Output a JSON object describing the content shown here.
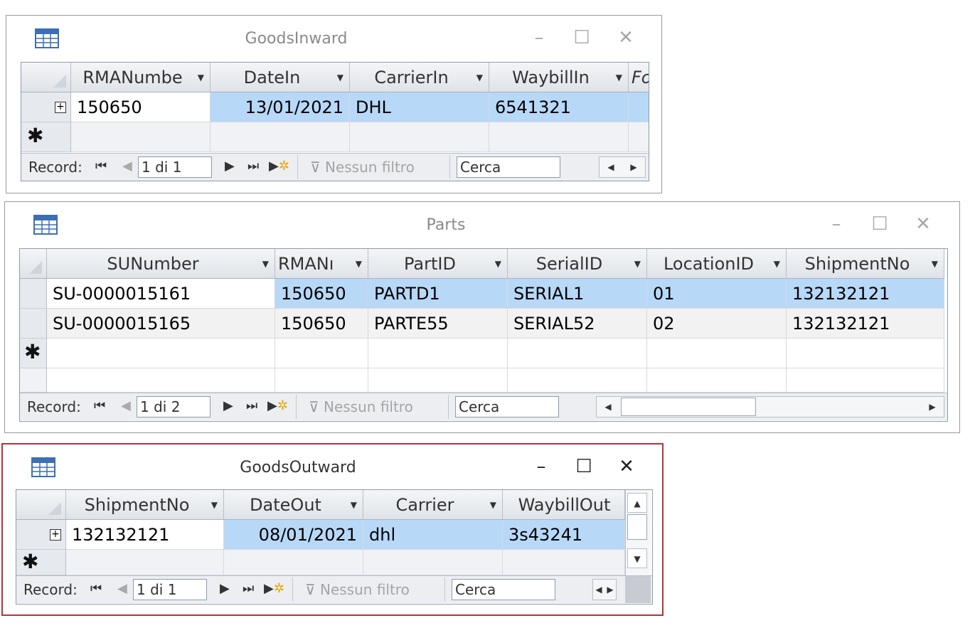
{
  "windows": {
    "inward": {
      "title": "GoodsInward",
      "columns": [
        "RMANumbe",
        "DateIn",
        "CarrierIn",
        "WaybillIn",
        "Fo"
      ],
      "row": [
        "150650",
        "13/01/2021",
        "DHL",
        "6541321"
      ],
      "nav": {
        "record_label": "Record:",
        "position": "1 di 1",
        "filter": "Nessun filtro",
        "search": "Cerca"
      }
    },
    "parts": {
      "title": "Parts",
      "columns": [
        "SUNumber",
        "RMANı",
        "PartID",
        "SerialID",
        "LocationID",
        "ShipmentNo"
      ],
      "rows": [
        [
          "SU-0000015161",
          "150650",
          "PARTD1",
          "SERIAL1",
          "01",
          "132132121"
        ],
        [
          "SU-0000015165",
          "150650",
          "PARTE55",
          "SERIAL52",
          "02",
          "132132121"
        ]
      ],
      "nav": {
        "record_label": "Record:",
        "position": "1 di 2",
        "filter": "Nessun filtro",
        "search": "Cerca"
      }
    },
    "outward": {
      "title": "GoodsOutward",
      "columns": [
        "ShipmentNo",
        "DateOut",
        "Carrier",
        "WaybillOut"
      ],
      "row": [
        "132132121",
        "08/01/2021",
        "dhl",
        "3s43241"
      ],
      "nav": {
        "record_label": "Record:",
        "position": "1 di 1",
        "filter": "Nessun filtro",
        "search": "Cerca"
      }
    }
  },
  "icons": {
    "table": "datasheet-table-icon",
    "new_row": "asterisk-icon",
    "expand": "plus-box-icon"
  },
  "colors": {
    "selected_cell": "#b8d8f8",
    "active_border": "#b0353a"
  }
}
